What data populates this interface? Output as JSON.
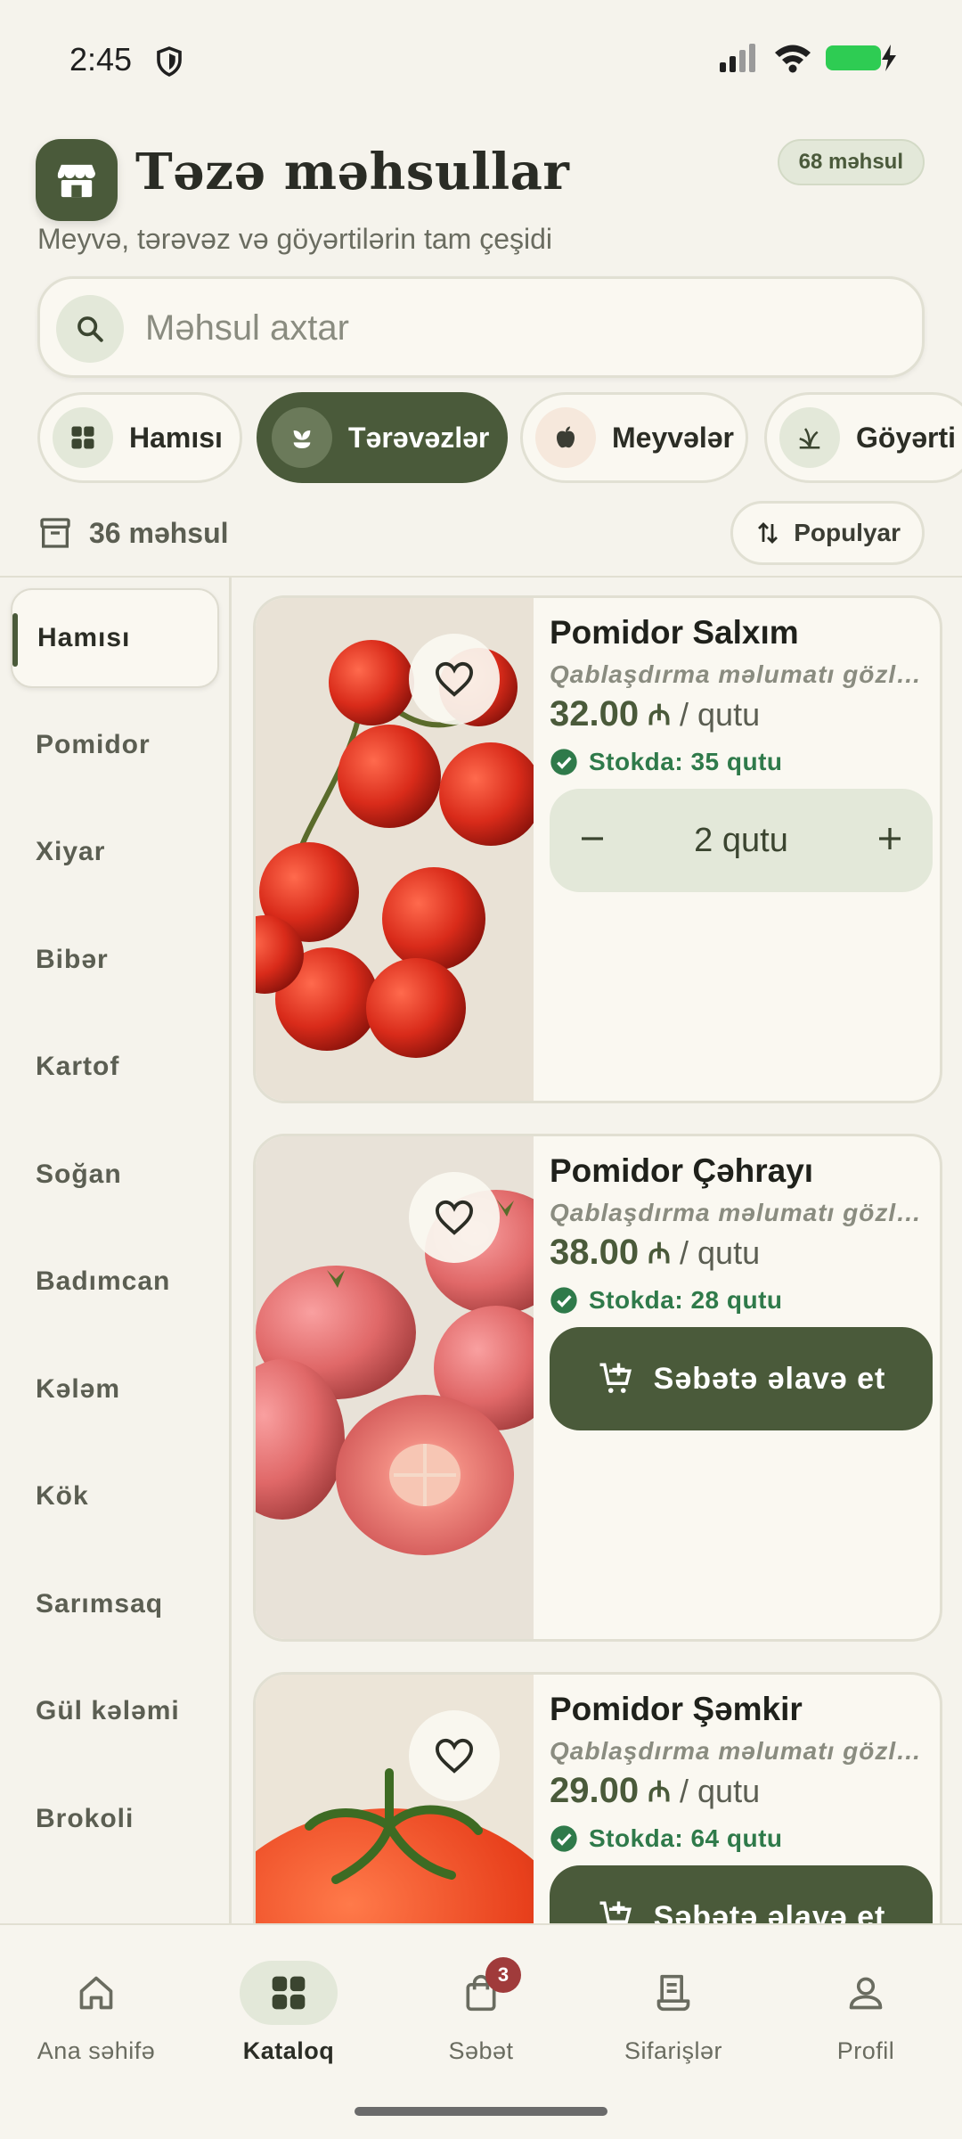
{
  "status_bar": {
    "time": "2:45"
  },
  "header": {
    "title": "Təzə məhsullar",
    "subtitle": "Meyvə, tərəvəz və göyərtilərin tam çeşidi",
    "count_badge": "68 məhsul",
    "icon": "storefront-icon"
  },
  "search": {
    "placeholder": "Məhsul axtar",
    "value": ""
  },
  "categories": [
    {
      "label": "Hamısı",
      "icon": "grid-icon",
      "active": false
    },
    {
      "label": "Tərəvəzlər",
      "icon": "sprout-icon",
      "active": true
    },
    {
      "label": "Meyvələr",
      "icon": "apple-icon",
      "active": false
    },
    {
      "label": "Göyərti",
      "icon": "herb-icon",
      "active": false
    }
  ],
  "list": {
    "count": "36 məhsul",
    "sort_label": "Populyar"
  },
  "sidebar": {
    "items": [
      {
        "label": "Hamısı",
        "active": true
      },
      {
        "label": "Pomidor"
      },
      {
        "label": "Xiyar"
      },
      {
        "label": "Bibər"
      },
      {
        "label": "Kartof"
      },
      {
        "label": "Soğan"
      },
      {
        "label": "Badımcan"
      },
      {
        "label": "Kələm"
      },
      {
        "label": "Kök"
      },
      {
        "label": "Sarımsaq"
      },
      {
        "label": "Gül kələmi"
      },
      {
        "label": "Brokoli"
      }
    ]
  },
  "products": [
    {
      "name": "Pomidor Salxım",
      "pack_info": "Qablaşdırma məlumatı gözlənilir",
      "price": "32.00",
      "currency": "₼",
      "unit": "/ qutu",
      "stock": "Stokda: 35 qutu",
      "in_cart_qty": "2 qutu"
    },
    {
      "name": "Pomidor Çəhrayı",
      "pack_info": "Qablaşdırma məlumatı gözlənilir",
      "price": "38.00",
      "currency": "₼",
      "unit": "/ qutu",
      "stock": "Stokda: 28 qutu",
      "add_label": "Səbətə əlavə et"
    },
    {
      "name": "Pomidor Şəmkir",
      "pack_info": "Qablaşdırma məlumatı gözlənilir",
      "price": "29.00",
      "currency": "₼",
      "unit": "/ qutu",
      "stock": "Stokda: 64 qutu",
      "add_label": "Səbətə əlavə et"
    }
  ],
  "bottom_nav": {
    "items": [
      {
        "label": "Ana səhifə",
        "icon": "home-icon"
      },
      {
        "label": "Kataloq",
        "icon": "catalog-grid-icon",
        "active": true
      },
      {
        "label": "Səbət",
        "icon": "shopping-bag-icon",
        "badge": "3"
      },
      {
        "label": "Sifarişlər",
        "icon": "receipt-icon"
      },
      {
        "label": "Profil",
        "icon": "person-icon"
      }
    ]
  },
  "colors": {
    "background": "#f5f3ec",
    "primary": "#4a5a3a",
    "primary_light": "#e3e8d9",
    "stock_green": "#2f7a4a",
    "badge_red": "#a03b3b"
  }
}
